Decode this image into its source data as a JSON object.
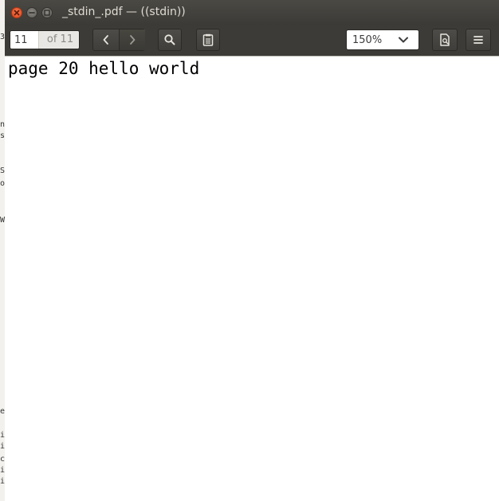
{
  "window": {
    "title": "_stdin_.pdf — ((stdin))"
  },
  "toolbar": {
    "page_current": "11",
    "page_total": "of 11",
    "zoom_value": "150%"
  },
  "document": {
    "text": "page 20 hello world"
  },
  "background_terminal": {
    "fragments": [
      "3",
      "n",
      "s",
      "S",
      "o",
      "W",
      "e",
      "i",
      "i",
      "c",
      "i",
      "i"
    ]
  },
  "colors": {
    "close_button": "#e0471c",
    "titlebar": "#3c3b37",
    "title_text": "#dfdbd2",
    "page_background": "#ffffff"
  },
  "icons": {
    "prev": "chevron-left-icon",
    "next": "chevron-right-icon",
    "search": "search-icon",
    "annotations": "clipboard-icon",
    "zoom_dropdown": "chevron-down-icon",
    "page_view": "document-icon",
    "menu": "hamburger-menu-icon"
  }
}
